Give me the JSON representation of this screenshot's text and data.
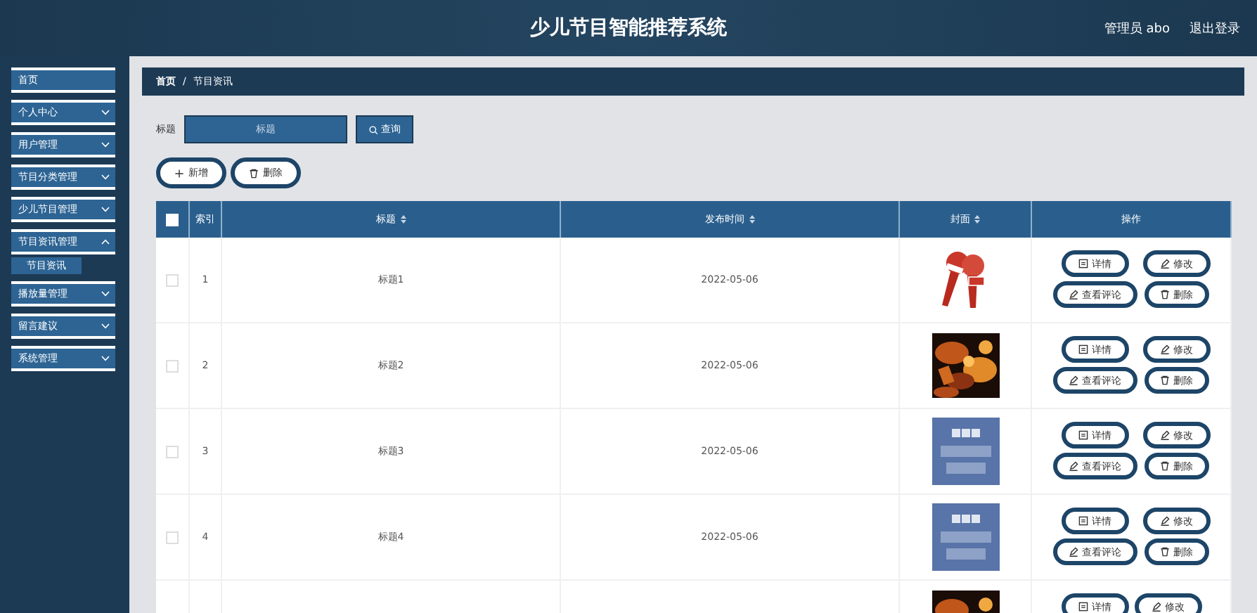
{
  "header": {
    "title": "少儿节目智能推荐系统",
    "user": "管理员 abo",
    "logout": "退出登录"
  },
  "sidebar": {
    "items": [
      {
        "label": "首页",
        "expandable": false
      },
      {
        "label": "个人中心",
        "expandable": true,
        "expanded": false
      },
      {
        "label": "用户管理",
        "expandable": true,
        "expanded": false
      },
      {
        "label": "节目分类管理",
        "expandable": true,
        "expanded": false
      },
      {
        "label": "少儿节目管理",
        "expandable": true,
        "expanded": false
      },
      {
        "label": "节目资讯管理",
        "expandable": true,
        "expanded": true,
        "children": [
          {
            "label": "节目资讯"
          }
        ]
      },
      {
        "label": "播放量管理",
        "expandable": true,
        "expanded": false
      },
      {
        "label": "留言建议",
        "expandable": true,
        "expanded": false
      },
      {
        "label": "系统管理",
        "expandable": true,
        "expanded": false
      }
    ]
  },
  "breadcrumb": {
    "items": [
      "首页",
      "节目资讯"
    ],
    "separator": "/"
  },
  "search": {
    "label": "标题",
    "placeholder": "标题",
    "button": "查询"
  },
  "toolbar": [
    {
      "label": "新增",
      "kind": "add"
    },
    {
      "label": "删除",
      "kind": "delete"
    }
  ],
  "table": {
    "select_all": {
      "checked": false
    },
    "columns": [
      {
        "label": "索引",
        "sortable": false
      },
      {
        "label": "标题",
        "sortable": true
      },
      {
        "label": "发布时间",
        "sortable": true
      },
      {
        "label": "封面",
        "sortable": true
      },
      {
        "label": "操作",
        "sortable": false
      }
    ],
    "rows": [
      {
        "checked": false,
        "index": "1",
        "title": "标题1",
        "date": "2022-05-06",
        "cover": {
          "kind": "microphone"
        },
        "actions": [
          {
            "label": "详情",
            "kind": "detail"
          },
          {
            "label": "修改",
            "kind": "edit"
          },
          {
            "label": "查看评论",
            "kind": "edit"
          },
          {
            "label": "删除",
            "kind": "delete"
          }
        ]
      },
      {
        "checked": false,
        "index": "2",
        "title": "标题2",
        "date": "2022-05-06",
        "cover": {
          "kind": "picture"
        },
        "actions": [
          {
            "label": "详情",
            "kind": "detail"
          },
          {
            "label": "修改",
            "kind": "edit"
          },
          {
            "label": "查看评论",
            "kind": "edit"
          },
          {
            "label": "删除",
            "kind": "delete"
          }
        ]
      },
      {
        "checked": false,
        "index": "3",
        "title": "标题3",
        "date": "2022-05-06",
        "cover": {
          "kind": "tile"
        },
        "actions": [
          {
            "label": "详情",
            "kind": "detail"
          },
          {
            "label": "修改",
            "kind": "edit"
          },
          {
            "label": "查看评论",
            "kind": "edit"
          },
          {
            "label": "删除",
            "kind": "delete"
          }
        ]
      },
      {
        "checked": false,
        "index": "4",
        "title": "标题4",
        "date": "2022-05-06",
        "cover": {
          "kind": "tile"
        },
        "actions": [
          {
            "label": "详情",
            "kind": "detail"
          },
          {
            "label": "修改",
            "kind": "edit"
          },
          {
            "label": "查看评论",
            "kind": "edit"
          },
          {
            "label": "删除",
            "kind": "delete"
          }
        ]
      },
      {
        "cover": {
          "kind": "picture"
        },
        "actions": [
          {
            "label": "详情",
            "kind": "detail"
          },
          {
            "label": "修改",
            "kind": "edit"
          }
        ]
      }
    ]
  }
}
